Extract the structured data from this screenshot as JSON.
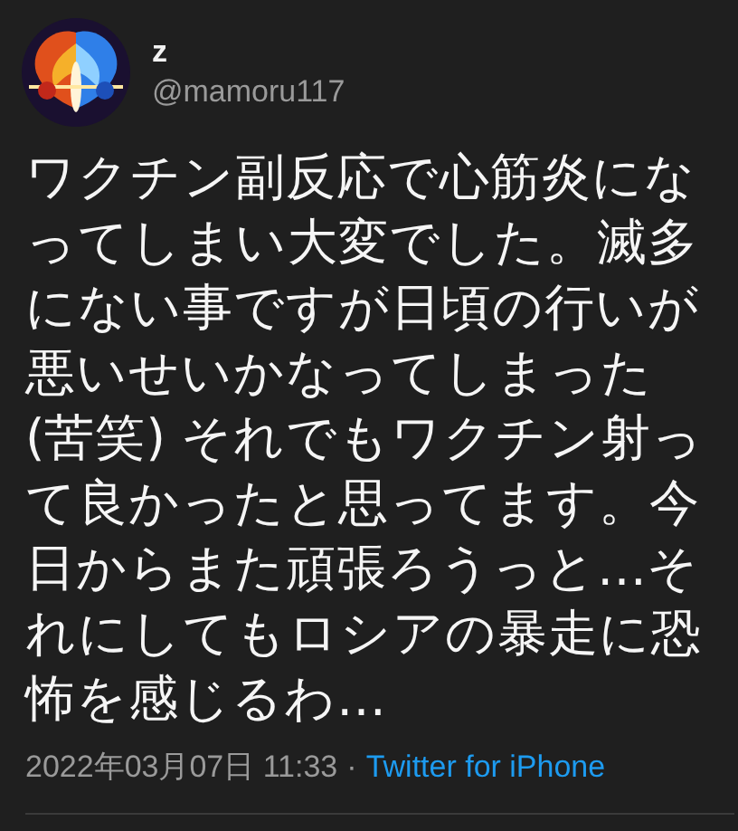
{
  "author": {
    "name": "z",
    "handle": "@mamoru117"
  },
  "tweet": {
    "text": "ワクチン副反応で心筋炎になってしまい大変でした。滅多にない事ですが日頃の行いが悪いせいかなってしまった(苦笑) それでもワクチン射って良かったと思ってます。今日からまた頑張ろうっと…それにしてもロシアの暴走に恐怖を感じるわ…"
  },
  "meta": {
    "timestamp": "2022年03月07日 11:33",
    "separator": "·",
    "source": "Twitter for iPhone"
  }
}
